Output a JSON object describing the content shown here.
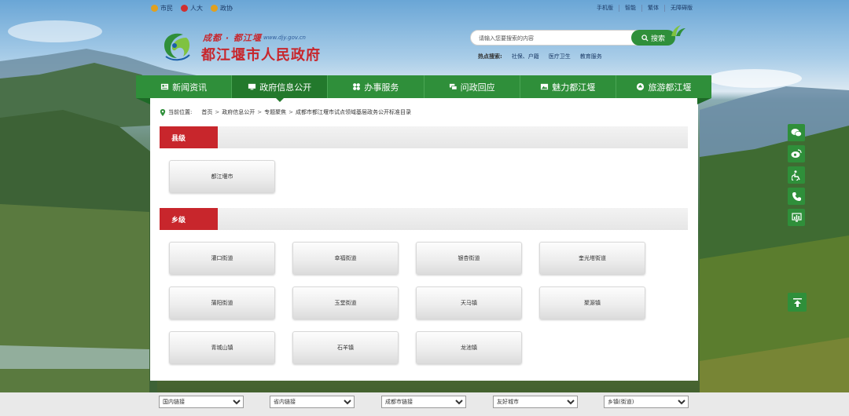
{
  "topbar": {
    "left": [
      {
        "label": "市民",
        "color": "#e0a020"
      },
      {
        "label": "人大",
        "color": "#d03030"
      },
      {
        "label": "政协",
        "color": "#e0a020"
      }
    ],
    "right": [
      "手机版",
      "智能",
      "繁体",
      "无障碍版"
    ]
  },
  "header": {
    "slogan": "成都 · 都江堰",
    "url": "www.djy.gov.cn",
    "site_title": "都江堰市人民政府",
    "search": {
      "placeholder": "请输入您要搜索的内容",
      "button_label": "搜索"
    },
    "hot": {
      "label": "热点搜索:",
      "links": [
        "社保、户籍",
        "医疗卫生",
        "教育服务"
      ]
    }
  },
  "nav": [
    {
      "label": "新闻资讯",
      "active": false,
      "icon": "news-icon"
    },
    {
      "label": "政府信息公开",
      "active": true,
      "icon": "monitor-icon"
    },
    {
      "label": "办事服务",
      "active": false,
      "icon": "grid-icon"
    },
    {
      "label": "问政回应",
      "active": false,
      "icon": "chat-icon"
    },
    {
      "label": "魅力都江堰",
      "active": false,
      "icon": "image-icon"
    },
    {
      "label": "旅游都江堰",
      "active": false,
      "icon": "travel-icon"
    }
  ],
  "breadcrumb": {
    "label": "当前位置:",
    "items": [
      "首页",
      "政府信息公开",
      "专题聚焦",
      "成都市都江堰市试点领域基层政务公开标准目录"
    ]
  },
  "sections": [
    {
      "title": "县级",
      "items": [
        "都江堰市"
      ]
    },
    {
      "title": "乡级",
      "items": [
        "灌口街道",
        "幸福街道",
        "银杏街道",
        "奎光塔街道",
        "蒲阳街道",
        "玉堂街道",
        "天马镇",
        "聚源镇",
        "青城山镇",
        "石羊镇",
        "龙池镇"
      ]
    }
  ],
  "float_tools": [
    "wechat-icon",
    "weibo-icon",
    "accessibility-icon",
    "phone-icon",
    "chart-icon"
  ],
  "footer": {
    "selects": [
      "国内链接",
      "省内链接",
      "成都市链接",
      "友好城市",
      "乡镇(街道)"
    ]
  },
  "colors": {
    "green": "#2f8f3a",
    "red": "#c8262c"
  }
}
